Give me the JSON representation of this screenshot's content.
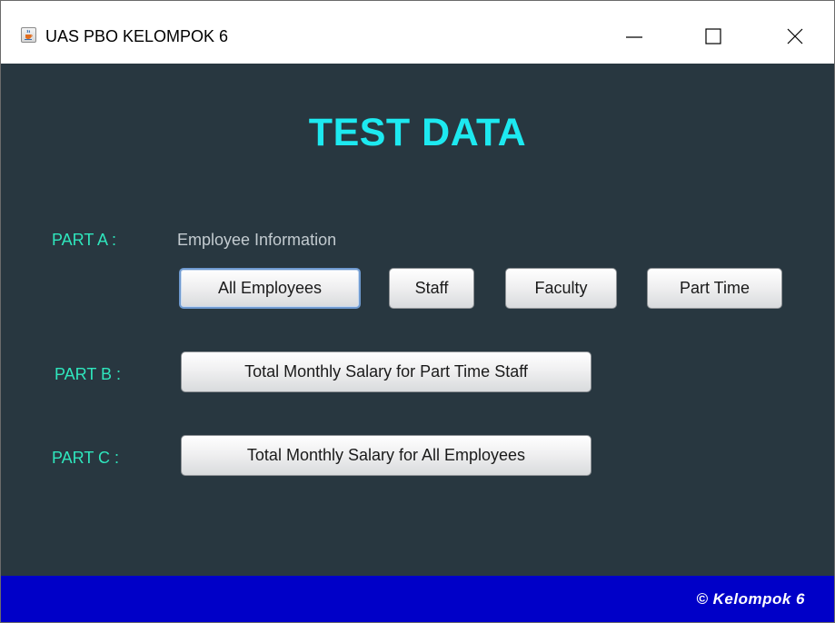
{
  "window": {
    "title": "UAS PBO KELOMPOK 6",
    "app_icon": "java-cup-icon",
    "controls": [
      "minimize-icon",
      "maximize-icon",
      "close-icon"
    ]
  },
  "main": {
    "title": "TEST DATA",
    "title_color": "#1de9f0",
    "background_color": "#283740",
    "part_a": {
      "label": "PART A :",
      "subtitle": "Employee Information",
      "buttons": [
        "All Employees",
        "Staff",
        "Faculty",
        "Part Time"
      ]
    },
    "part_b": {
      "label": "PART B :",
      "button": "Total Monthly Salary for Part Time Staff"
    },
    "part_c": {
      "label": "PART C :",
      "button": "Total Monthly Salary for All Employees"
    },
    "label_color": "#2fe6bd"
  },
  "footer": {
    "text": "© Kelompok 6",
    "background_color": "#0000c8"
  }
}
